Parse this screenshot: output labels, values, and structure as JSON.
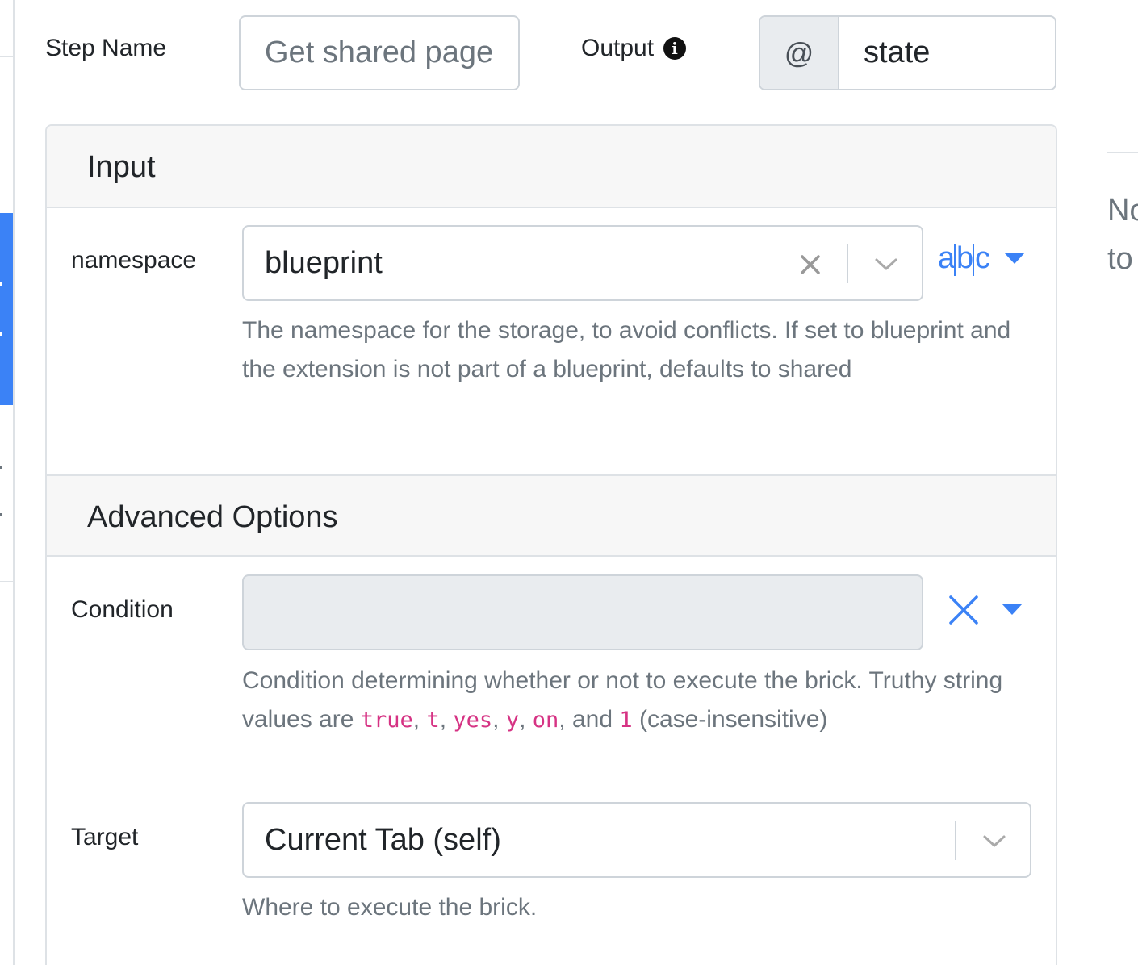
{
  "header": {
    "step_name_label": "Step Name",
    "step_name_value": "Get shared page",
    "output_label": "Output",
    "output_info_icon": "info-circle-icon",
    "output_prefix": "@",
    "output_value": "state"
  },
  "input_section": {
    "title": "Input",
    "namespace": {
      "label": "namespace",
      "value": "blueprint",
      "clear_icon": "close-icon",
      "dropdown_icon": "chevron-down-icon",
      "type_toggle_icon": "text-type-icon",
      "type_toggle_text": "a|b|c",
      "caret_icon": "caret-down-icon",
      "help": "The namespace for the storage, to avoid conflicts. If set to blueprint and the extension is not part of a blueprint, defaults to shared"
    }
  },
  "advanced_section": {
    "title": "Advanced Options",
    "condition": {
      "label": "Condition",
      "value": "",
      "clear_icon": "close-icon",
      "caret_icon": "caret-down-icon",
      "help_prefix": "Condition determining whether or not to execute the brick. Truthy string values are ",
      "truthy_values": [
        "true",
        "t",
        "yes",
        "y",
        "on",
        "1"
      ],
      "help_sep": ", ",
      "help_and": ", and ",
      "help_suffix": " (case-insensitive)"
    },
    "target": {
      "label": "Target",
      "value": "Current Tab (self)",
      "dropdown_icon": "chevron-down-icon",
      "help": "Where to execute the brick."
    }
  },
  "right_panel": {
    "line1": "No",
    "line2": "to"
  },
  "colors": {
    "accent": "#3b82f6",
    "code": "#d63384",
    "muted": "#6c757d",
    "border": "#ced4da",
    "header_bg": "#f7f7f7"
  }
}
